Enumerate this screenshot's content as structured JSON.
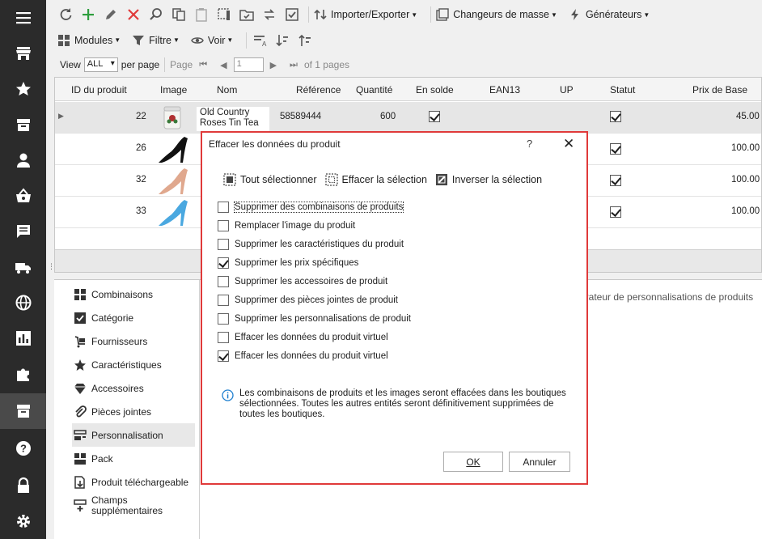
{
  "toolbar": {
    "import_export_label": "Importer/Exporter",
    "mass_changers_label": "Changeurs de masse",
    "generators_label": "Générateurs",
    "modules_label": "Modules",
    "filter_label": "Filtre",
    "view_label": "Voir"
  },
  "pager": {
    "view_label": "View",
    "view_value": "ALL",
    "per_page_label": "per page",
    "page_label": "Page",
    "page_value": "1",
    "of_pages": "of 1 pages"
  },
  "grid": {
    "columns": [
      "ID du produit",
      "Image",
      "Nom",
      "Référence",
      "Quantité",
      "En solde",
      "EAN13",
      "UPC",
      "Statut",
      "Prix de Base"
    ],
    "rows": [
      {
        "id": "22",
        "name": "Old Country Roses Tin Tea",
        "reference": "58589444",
        "quantity": "600",
        "on_sale": true,
        "status": true,
        "price": "45.00"
      },
      {
        "id": "26",
        "status": true,
        "price": "100.00"
      },
      {
        "id": "32",
        "status": true,
        "price": "100.00"
      },
      {
        "id": "33",
        "status": true,
        "price": "100.00"
      }
    ]
  },
  "modules": [
    {
      "label": "Combinaisons",
      "icon": "combinations-icon"
    },
    {
      "label": "Catégorie",
      "icon": "category-icon"
    },
    {
      "label": "Fournisseurs",
      "icon": "suppliers-icon"
    },
    {
      "label": "Caractéristiques",
      "icon": "features-icon"
    },
    {
      "label": "Accessoires",
      "icon": "accessories-icon"
    },
    {
      "label": "Pièces jointes",
      "icon": "attachments-icon"
    },
    {
      "label": "Personnalisation",
      "icon": "customization-icon"
    },
    {
      "label": "Pack",
      "icon": "pack-icon"
    },
    {
      "label": "Produit téléchargeable",
      "icon": "downloadable-icon"
    },
    {
      "label": "Champs supplémentaires",
      "icon": "extra-fields-icon"
    }
  ],
  "generator_text": "érateur de personnalisations de produits",
  "dialog": {
    "title": "Effacer les données du produit",
    "help": "?",
    "close": "✕",
    "select_all": "Tout sélectionner",
    "clear_selection": "Effacer la sélection",
    "invert_selection": "Inverser la sélection",
    "options": [
      {
        "label": "Supprimer des combinaisons de produits",
        "checked": false
      },
      {
        "label": "Remplacer l'image du produit",
        "checked": false
      },
      {
        "label": "Supprimer les caractéristiques du produit",
        "checked": false
      },
      {
        "label": "Supprimer les prix spécifiques",
        "checked": true
      },
      {
        "label": "Supprimer les accessoires de produit",
        "checked": false
      },
      {
        "label": "Supprimer des pièces jointes de produit",
        "checked": false
      },
      {
        "label": "Supprimer les personnalisations de produit",
        "checked": false
      },
      {
        "label": "Effacer les données du produit virtuel",
        "checked": false
      },
      {
        "label": "Effacer les données du produit virtuel",
        "checked": true
      }
    ],
    "info": "Les combinaisons de produits et les images seront effacées dans les boutiques sélectionnées. Toutes les autres entités seront définitivement supprimées de toutes les boutiques.",
    "ok_label": "OK",
    "cancel_label": "Annuler"
  },
  "colors": {
    "sidebar_bg": "#2b2b2b",
    "accent_green": "#2e9e3e",
    "delete_red": "#e03a3a",
    "info_blue": "#1e7fd0"
  }
}
